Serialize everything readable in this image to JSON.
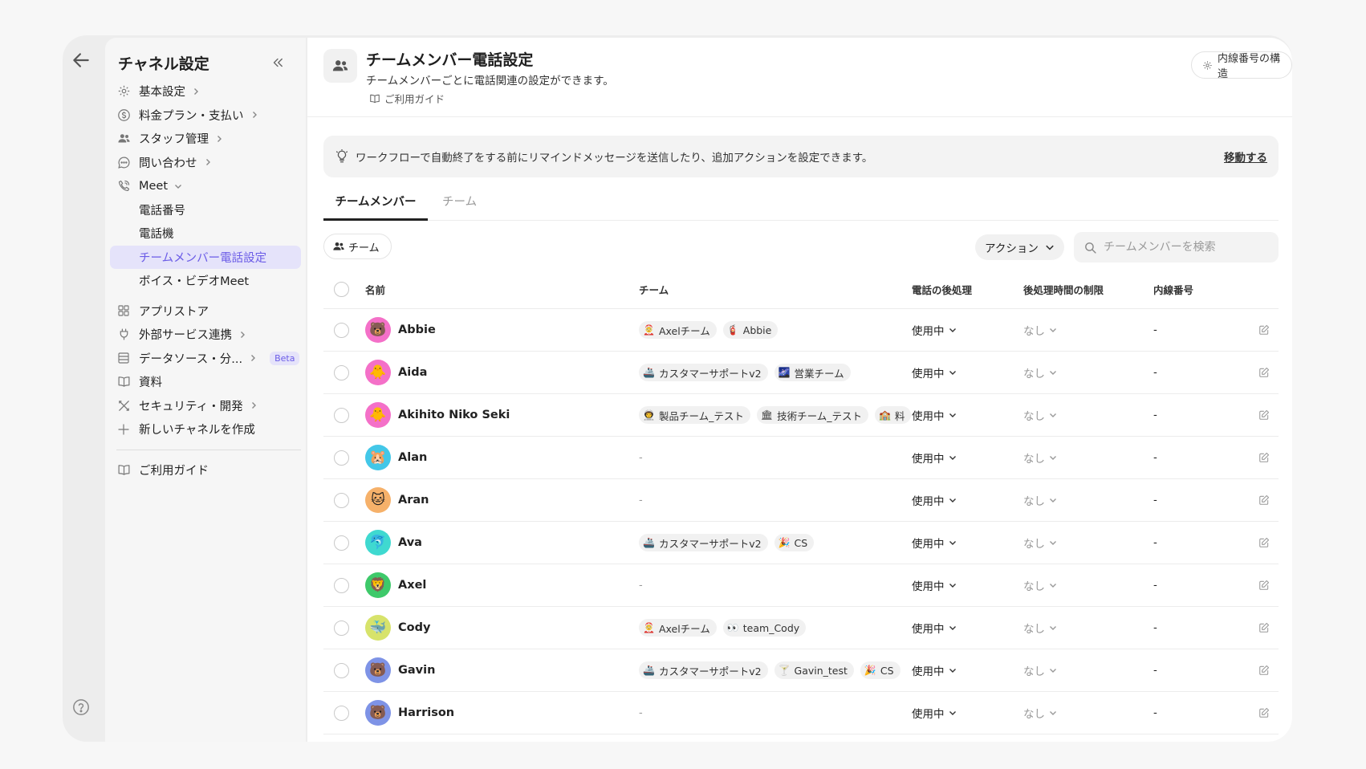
{
  "sidebar": {
    "title": "チャネル設定",
    "items": [
      {
        "label": "基本設定",
        "icon": "gear-icon"
      },
      {
        "label": "料金プラン・支払い",
        "icon": "dollar-circle-icon"
      },
      {
        "label": "スタッフ管理",
        "icon": "people-icon"
      },
      {
        "label": "問い合わせ",
        "icon": "chat-icon"
      },
      {
        "label": "Meet",
        "icon": "phone-icon"
      },
      {
        "label": "電話番号"
      },
      {
        "label": "電話機"
      },
      {
        "label": "チームメンバー電話設定"
      },
      {
        "label": "ボイス・ビデオMeet"
      },
      {
        "label": "アプリストア",
        "icon": "grid-icon"
      },
      {
        "label": "外部サービス連携",
        "icon": "plug-icon"
      },
      {
        "label": "データソース・分...",
        "icon": "database-icon",
        "badge": "Beta"
      },
      {
        "label": "資料",
        "icon": "book-icon"
      },
      {
        "label": "セキュリティ・開発",
        "icon": "tools-icon"
      },
      {
        "label": "新しいチャネルを作成",
        "icon": "plus-icon"
      },
      {
        "label": "ご利用ガイド",
        "icon": "book-icon"
      }
    ]
  },
  "header": {
    "title": "チームメンバー電話設定",
    "subtitle": "チームメンバーごとに電話関連の設定ができます。",
    "guide": "ご利用ガイド",
    "struct_button": "内線番号の構造"
  },
  "banner": {
    "text": "ワークフローで自動終了をする前にリマインドメッセージを送信したり、追加アクションを設定できます。",
    "link": "移動する"
  },
  "tabs": [
    "チームメンバー",
    "チーム"
  ],
  "filter_chip": "チーム",
  "action_button": "アクション",
  "search_placeholder": "チームメンバーを検索",
  "columns": [
    "名前",
    "チーム",
    "電話の後処理",
    "後処理時間の制限",
    "内線番号"
  ],
  "rows": [
    {
      "name": "Abbie",
      "avatar": "🐻",
      "avatar_bg": "#f470c8",
      "teams": [
        {
          "emoji": "🤶",
          "label": "Axelチーム"
        },
        {
          "emoji": "🧯",
          "label": "Abbie"
        }
      ],
      "post": "使用中",
      "limit": "なし",
      "ext": "-"
    },
    {
      "name": "Aida",
      "avatar": "🐥",
      "avatar_bg": "#f470c8",
      "teams": [
        {
          "emoji": "🚢",
          "label": "カスタマーサポートv2"
        },
        {
          "emoji": "🌌",
          "label": "営業チーム"
        }
      ],
      "post": "使用中",
      "limit": "なし",
      "ext": "-"
    },
    {
      "name": "Akihito Niko Seki",
      "avatar": "🐥",
      "avatar_bg": "#f470c8",
      "teams": [
        {
          "emoji": "👨‍🚀",
          "label": "製品チーム_テスト"
        },
        {
          "emoji": "🏛",
          "label": "技術チーム_テスト"
        },
        {
          "emoji": "🏫",
          "label": "料"
        }
      ],
      "post": "使用中",
      "limit": "なし",
      "ext": "-"
    },
    {
      "name": "Alan",
      "avatar": "🐹",
      "avatar_bg": "#43c7e8",
      "teams": [],
      "post": "使用中",
      "limit": "なし",
      "ext": "-"
    },
    {
      "name": "Aran",
      "avatar": "🐱",
      "avatar_bg": "#f6b16a",
      "teams": [],
      "post": "使用中",
      "limit": "なし",
      "ext": "-"
    },
    {
      "name": "Ava",
      "avatar": "🐬",
      "avatar_bg": "#3fd9d0",
      "teams": [
        {
          "emoji": "🚢",
          "label": "カスタマーサポートv2"
        },
        {
          "emoji": "🎉",
          "label": "CS"
        }
      ],
      "post": "使用中",
      "limit": "なし",
      "ext": "-"
    },
    {
      "name": "Axel",
      "avatar": "🦁",
      "avatar_bg": "#3ec96a",
      "teams": [],
      "post": "使用中",
      "limit": "なし",
      "ext": "-"
    },
    {
      "name": "Cody",
      "avatar": "🐳",
      "avatar_bg": "#d7e36b",
      "teams": [
        {
          "emoji": "🤶",
          "label": "Axelチーム"
        },
        {
          "emoji": "👀",
          "label": "team_Cody"
        }
      ],
      "post": "使用中",
      "limit": "なし",
      "ext": "-"
    },
    {
      "name": "Gavin",
      "avatar": "🐻",
      "avatar_bg": "#7e93e6",
      "teams": [
        {
          "emoji": "🚢",
          "label": "カスタマーサポートv2"
        },
        {
          "emoji": "🍸",
          "label": "Gavin_test"
        },
        {
          "emoji": "🎉",
          "label": "CS"
        }
      ],
      "post": "使用中",
      "limit": "なし",
      "ext": "-"
    },
    {
      "name": "Harrison",
      "avatar": "🐻",
      "avatar_bg": "#7e93e6",
      "teams": [],
      "post": "使用中",
      "limit": "なし",
      "ext": "-"
    }
  ],
  "colors": {
    "accent": "#6b5ce7",
    "accent_bg": "#e5e3fa"
  }
}
